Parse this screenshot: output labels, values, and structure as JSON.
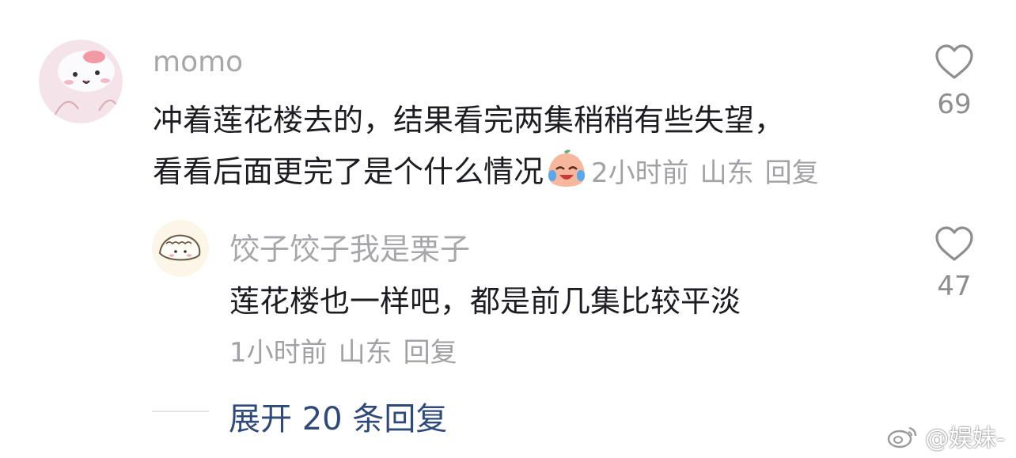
{
  "comment": {
    "username": "momo",
    "text_line1": "冲着莲花楼去的，结果看完两集稍稍有些失望，",
    "text_line2": "看看后面更完了是个什么情况",
    "emoji": "crying-laughing-emoji",
    "time": "2小时前",
    "location": "山东",
    "reply_label": "回复",
    "likes": "69"
  },
  "reply": {
    "username": "饺子饺子我是栗子",
    "text": "莲花楼也一样吧，都是前几集比较平淡",
    "time": "1小时前",
    "location": "山东",
    "reply_label": "回复",
    "likes": "47"
  },
  "expand_label": "展开 20 条回复",
  "watermark": "@娱妹-",
  "colors": {
    "username": "#a7a7ab",
    "meta": "#a1a1a6",
    "link": "#2f4a78"
  }
}
